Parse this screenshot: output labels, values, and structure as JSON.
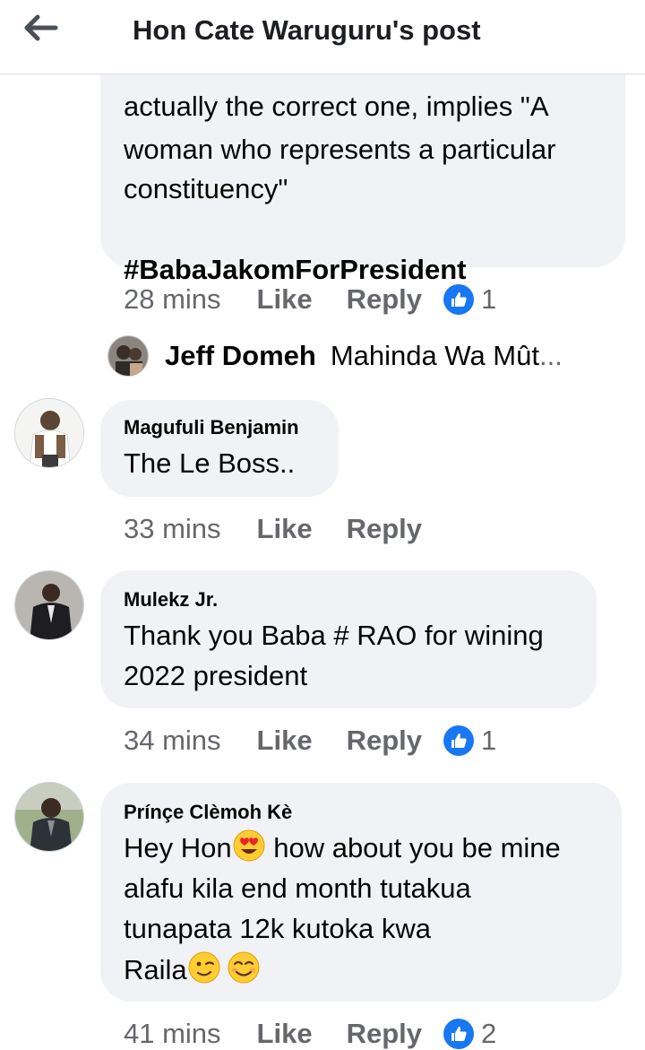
{
  "header": {
    "title": "Hon Cate Waruguru's post"
  },
  "comments": [
    {
      "partial_line": "actually the correct one, implies \"A",
      "text_lines": [
        "woman who represents a particular",
        "constituency\""
      ],
      "hashtag": "#BabaJakomForPresident",
      "time": "28 mins",
      "like_label": "Like",
      "reply_label": "Reply",
      "reactions": "1"
    },
    {
      "author": "Magufuli Benjamin",
      "text_lines": [
        "The Le Boss.."
      ],
      "time": "33 mins",
      "like_label": "Like",
      "reply_label": "Reply"
    },
    {
      "author": "Mulekz Jr.",
      "text_lines": [
        "Thank you Baba # RAO for wining",
        "2022 president"
      ],
      "time": "34 mins",
      "like_label": "Like",
      "reply_label": "Reply",
      "reactions": "1"
    },
    {
      "author": "Prínçe Clèmoh Kè",
      "text_lines": [
        "Hey Hon",
        " how about you be mine",
        "alafu kila end month tutakua",
        "tunapata 12k kutoka kwa",
        "Raila"
      ],
      "time": "41 mins",
      "like_label": "Like",
      "reply_label": "Reply",
      "reactions": "2"
    }
  ],
  "reply_preview": {
    "name": "Jeff Domeh",
    "text": "Mahinda Wa Mût",
    "ellipsis": "..."
  },
  "colors": {
    "bubble": "#f0f2f5",
    "meta_text": "#65676b",
    "hashtag": "#385898",
    "like_badge": "#1877f2"
  },
  "icons": {
    "back": "arrow-left-icon",
    "like_reaction": "thumbs-up-icon",
    "emoji_heart_eyes": "heart-eyes-emoji",
    "emoji_wink": "wink-emoji",
    "emoji_smile": "smiling-emoji"
  }
}
